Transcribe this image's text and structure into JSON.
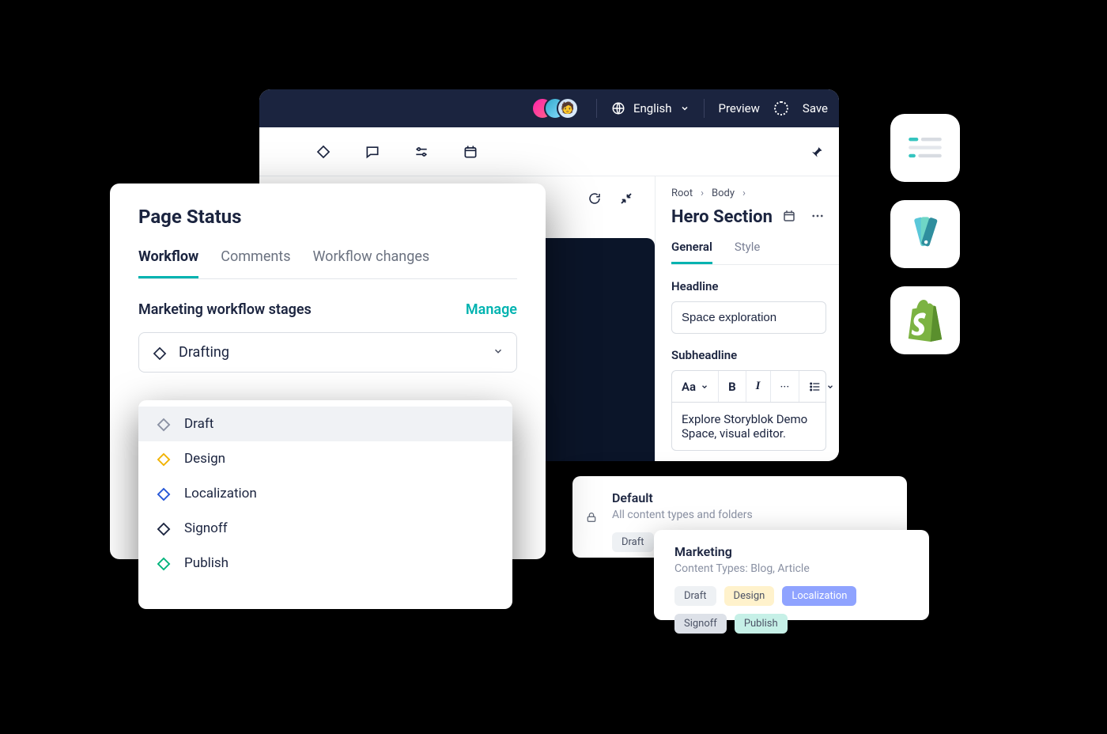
{
  "editor": {
    "topbar": {
      "language": "English",
      "preview": "Preview",
      "save": "Save"
    },
    "breadcrumb": {
      "root": "Root",
      "body": "Body"
    },
    "section_title": "Hero Section",
    "tabs": {
      "general": "General",
      "style": "Style"
    },
    "fields": {
      "headline_label": "Headline",
      "headline_value": "Space exploration",
      "subheadline_label": "Subheadline",
      "rte_aa": "Aa",
      "rte_bold": "B",
      "rte_italic": "I",
      "rte_more": "···",
      "rte_text": "Explore Storyblok Demo Space, visual editor."
    }
  },
  "page_status": {
    "title": "Page Status",
    "tabs": {
      "workflow": "Workflow",
      "comments": "Comments",
      "changes": "Workflow changes"
    },
    "section_label": "Marketing workflow stages",
    "manage": "Manage",
    "selected_stage": "Drafting",
    "options": [
      {
        "label": "Draft",
        "color": "#8a91a3"
      },
      {
        "label": "Design",
        "color": "#f2b200"
      },
      {
        "label": "Localization",
        "color": "#2355d6"
      },
      {
        "label": "Signoff",
        "color": "#1b243f"
      },
      {
        "label": "Publish",
        "color": "#00b37a"
      }
    ]
  },
  "workflows": {
    "default": {
      "title": "Default",
      "subtitle": "All content types and folders",
      "chips": [
        {
          "label": "Draft",
          "variant": ""
        }
      ]
    },
    "marketing": {
      "title": "Marketing",
      "subtitle": "Content Types: Blog, Article",
      "chips": [
        {
          "label": "Draft",
          "variant": ""
        },
        {
          "label": "Design",
          "variant": "yellow"
        },
        {
          "label": "Localization",
          "variant": "blue"
        },
        {
          "label": "Signoff",
          "variant": "gray2"
        },
        {
          "label": "Publish",
          "variant": "teal"
        }
      ]
    }
  }
}
